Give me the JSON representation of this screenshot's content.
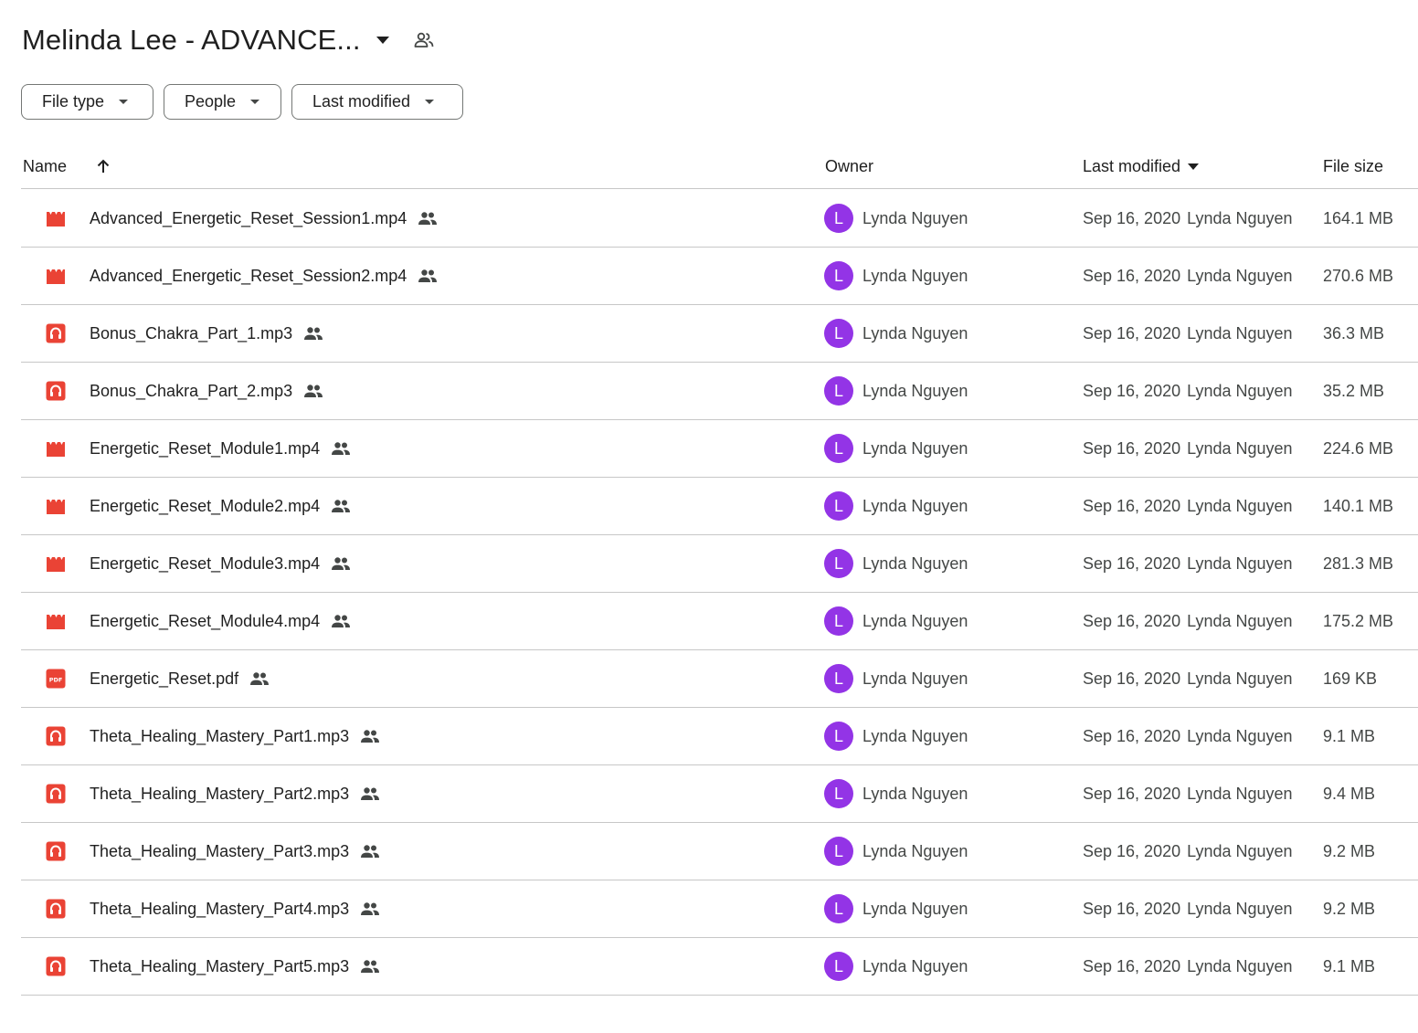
{
  "title": "Melinda Lee - ADVANCE...",
  "icons": {
    "title_caret": "caret-down-icon",
    "title_share": "shared-people-icon",
    "video": "video-file-icon",
    "audio": "audio-file-icon",
    "pdf": "pdf-file-icon",
    "shared": "shared-icon",
    "sort": "arrow-up-icon"
  },
  "colors": {
    "file_icon_red": "#ea4335",
    "avatar_purple": "#9334e6",
    "divider": "#c7c7c7",
    "chip_border": "#747775"
  },
  "filters": {
    "file_type": "File type",
    "people": "People",
    "last_modified": "Last modified"
  },
  "columns": {
    "name": "Name",
    "owner": "Owner",
    "last_modified": "Last modified",
    "file_size": "File size"
  },
  "files": [
    {
      "type": "video",
      "name": "Advanced_Energetic_Reset_Session1.mp4",
      "avatar": "L",
      "owner": "Lynda Nguyen",
      "date": "Sep 16, 2020",
      "modified_by": "Lynda Nguyen",
      "size": "164.1 MB"
    },
    {
      "type": "video",
      "name": "Advanced_Energetic_Reset_Session2.mp4",
      "avatar": "L",
      "owner": "Lynda Nguyen",
      "date": "Sep 16, 2020",
      "modified_by": "Lynda Nguyen",
      "size": "270.6 MB"
    },
    {
      "type": "audio",
      "name": "Bonus_Chakra_Part_1.mp3",
      "avatar": "L",
      "owner": "Lynda Nguyen",
      "date": "Sep 16, 2020",
      "modified_by": "Lynda Nguyen",
      "size": "36.3 MB"
    },
    {
      "type": "audio",
      "name": "Bonus_Chakra_Part_2.mp3",
      "avatar": "L",
      "owner": "Lynda Nguyen",
      "date": "Sep 16, 2020",
      "modified_by": "Lynda Nguyen",
      "size": "35.2 MB"
    },
    {
      "type": "video",
      "name": "Energetic_Reset_Module1.mp4",
      "avatar": "L",
      "owner": "Lynda Nguyen",
      "date": "Sep 16, 2020",
      "modified_by": "Lynda Nguyen",
      "size": "224.6 MB"
    },
    {
      "type": "video",
      "name": "Energetic_Reset_Module2.mp4",
      "avatar": "L",
      "owner": "Lynda Nguyen",
      "date": "Sep 16, 2020",
      "modified_by": "Lynda Nguyen",
      "size": "140.1 MB"
    },
    {
      "type": "video",
      "name": "Energetic_Reset_Module3.mp4",
      "avatar": "L",
      "owner": "Lynda Nguyen",
      "date": "Sep 16, 2020",
      "modified_by": "Lynda Nguyen",
      "size": "281.3 MB"
    },
    {
      "type": "video",
      "name": "Energetic_Reset_Module4.mp4",
      "avatar": "L",
      "owner": "Lynda Nguyen",
      "date": "Sep 16, 2020",
      "modified_by": "Lynda Nguyen",
      "size": "175.2 MB"
    },
    {
      "type": "pdf",
      "name": "Energetic_Reset.pdf",
      "avatar": "L",
      "owner": "Lynda Nguyen",
      "date": "Sep 16, 2020",
      "modified_by": "Lynda Nguyen",
      "size": "169 KB"
    },
    {
      "type": "audio",
      "name": "Theta_Healing_Mastery_Part1.mp3",
      "avatar": "L",
      "owner": "Lynda Nguyen",
      "date": "Sep 16, 2020",
      "modified_by": "Lynda Nguyen",
      "size": "9.1 MB"
    },
    {
      "type": "audio",
      "name": "Theta_Healing_Mastery_Part2.mp3",
      "avatar": "L",
      "owner": "Lynda Nguyen",
      "date": "Sep 16, 2020",
      "modified_by": "Lynda Nguyen",
      "size": "9.4 MB"
    },
    {
      "type": "audio",
      "name": "Theta_Healing_Mastery_Part3.mp3",
      "avatar": "L",
      "owner": "Lynda Nguyen",
      "date": "Sep 16, 2020",
      "modified_by": "Lynda Nguyen",
      "size": "9.2 MB"
    },
    {
      "type": "audio",
      "name": "Theta_Healing_Mastery_Part4.mp3",
      "avatar": "L",
      "owner": "Lynda Nguyen",
      "date": "Sep 16, 2020",
      "modified_by": "Lynda Nguyen",
      "size": "9.2 MB"
    },
    {
      "type": "audio",
      "name": "Theta_Healing_Mastery_Part5.mp3",
      "avatar": "L",
      "owner": "Lynda Nguyen",
      "date": "Sep 16, 2020",
      "modified_by": "Lynda Nguyen",
      "size": "9.1 MB"
    }
  ]
}
